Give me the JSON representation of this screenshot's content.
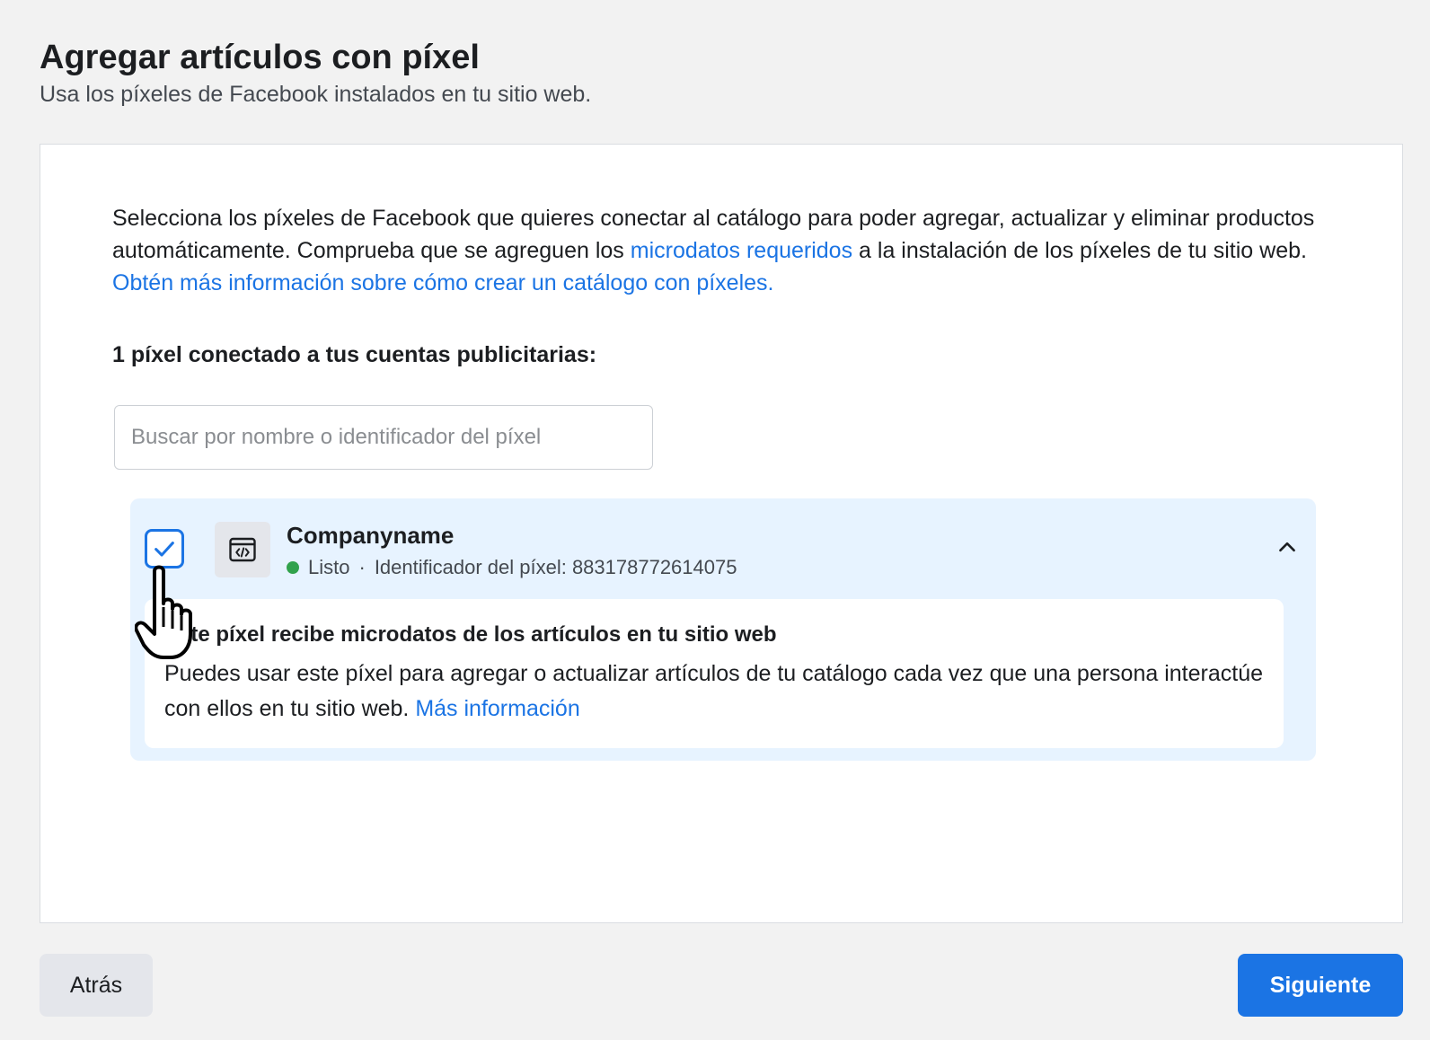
{
  "header": {
    "title": "Agregar artículos con píxel",
    "subtitle": "Usa los píxeles de Facebook instalados en tu sitio web."
  },
  "intro": {
    "text_1": "Selecciona los píxeles de Facebook que quieres conectar al catálogo para poder agregar, actualizar y eliminar productos automáticamente. Comprueba que se agreguen los ",
    "link_microdata": "microdatos requeridos",
    "text_2": " a la instalación de los píxeles de tu sitio web. ",
    "link_learn": "Obtén más información sobre cómo crear un catálogo con píxeles."
  },
  "section": {
    "label": "1 píxel conectado a tus cuentas publicitarias:"
  },
  "search": {
    "placeholder": "Buscar por nombre o identificador del píxel",
    "value": ""
  },
  "pixel": {
    "name": "Companyname",
    "status": "Listo",
    "separator": "·",
    "id_label": "Identificador del píxel: 883178772614075",
    "checked": true,
    "status_color": "#31a24c",
    "detail_title": "Este píxel recibe microdatos de los artículos en tu sitio web",
    "detail_text": "Puedes usar este píxel para agregar o actualizar artículos de tu catálogo cada vez que una persona interactúe con ellos en tu sitio web. ",
    "detail_link": "Más información"
  },
  "footer": {
    "back_label": "Atrás",
    "next_label": "Siguiente"
  },
  "colors": {
    "accent": "#1b74e4",
    "panel": "#e7f3ff",
    "background": "#f2f2f2"
  }
}
